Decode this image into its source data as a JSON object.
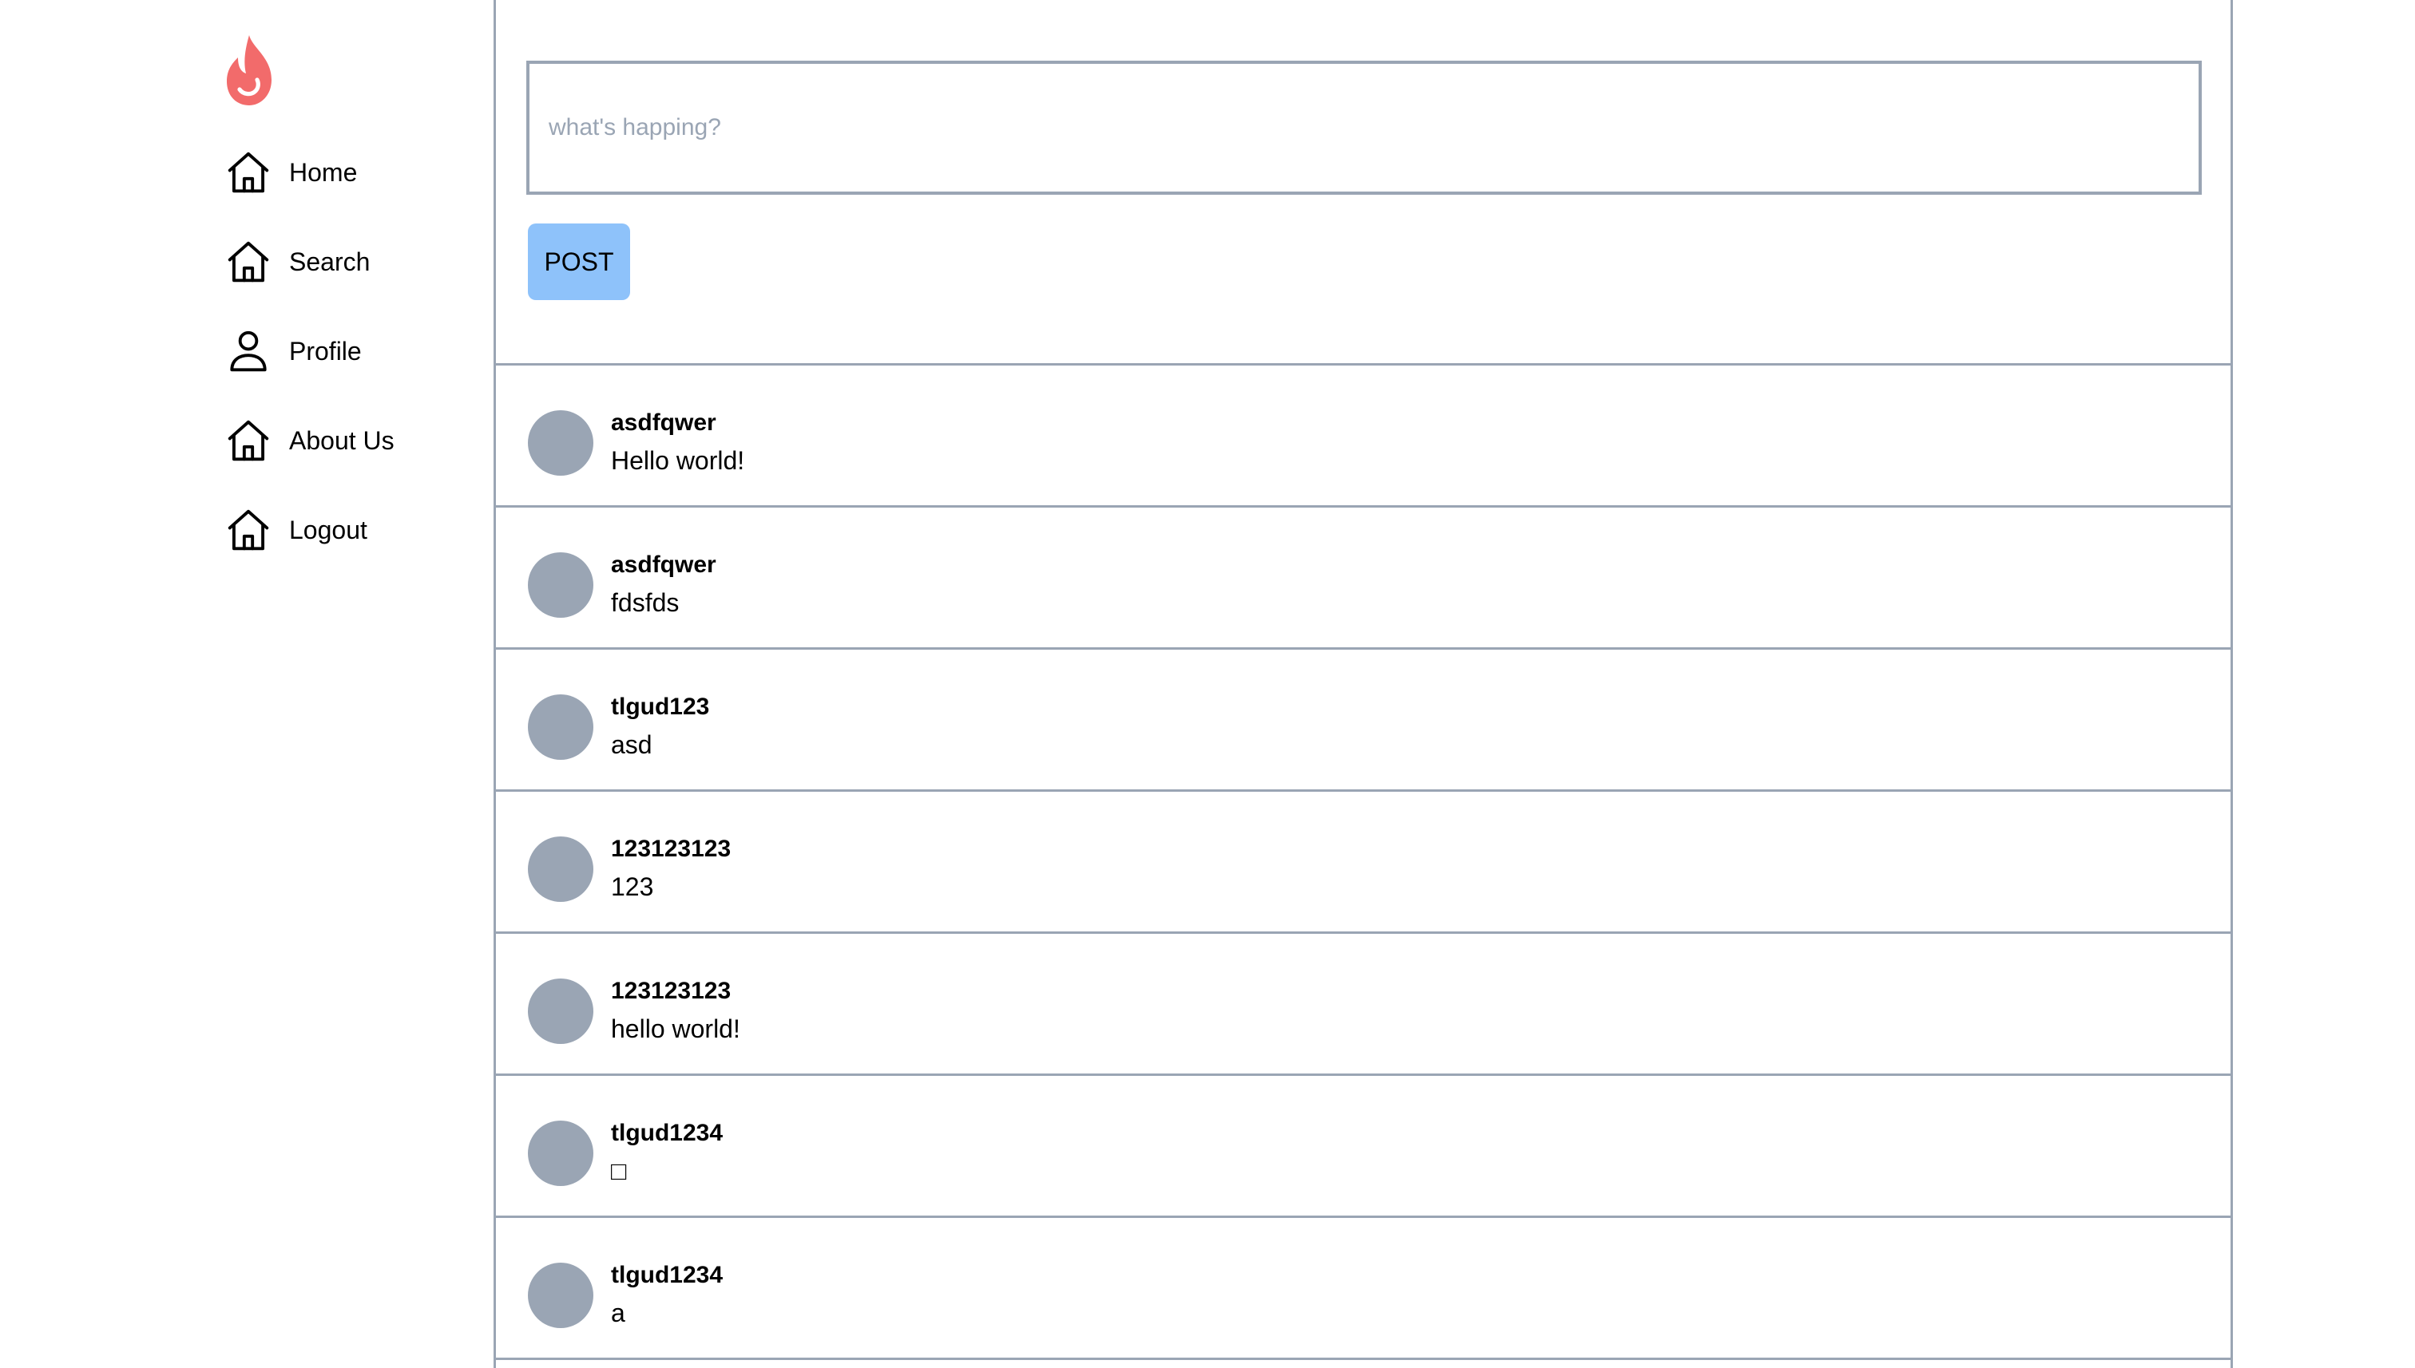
{
  "sidebar": {
    "logo_icon": "flame-icon",
    "logo_color": "#f26b6b",
    "nav": [
      {
        "label": "Home",
        "icon": "home-icon"
      },
      {
        "label": "Search",
        "icon": "home-icon"
      },
      {
        "label": "Profile",
        "icon": "user-icon"
      },
      {
        "label": "About Us",
        "icon": "home-icon"
      },
      {
        "label": "Logout",
        "icon": "home-icon"
      }
    ]
  },
  "composer": {
    "placeholder": "what's happing?",
    "value": "",
    "post_label": "POST",
    "post_button_color": "#8ec2fa"
  },
  "feed": [
    {
      "author": "asdfqwer",
      "body": "Hello world!"
    },
    {
      "author": "asdfqwer",
      "body": "fdsfds"
    },
    {
      "author": "tlgud123",
      "body": "asd"
    },
    {
      "author": "123123123",
      "body": "123"
    },
    {
      "author": "123123123",
      "body": "hello world!"
    },
    {
      "author": "tlgud1234",
      "body": "□"
    },
    {
      "author": "tlgud1234",
      "body": "a"
    }
  ],
  "colors": {
    "border": "#9aa5b4",
    "avatar": "#9aa5b4",
    "text": "#000000"
  }
}
